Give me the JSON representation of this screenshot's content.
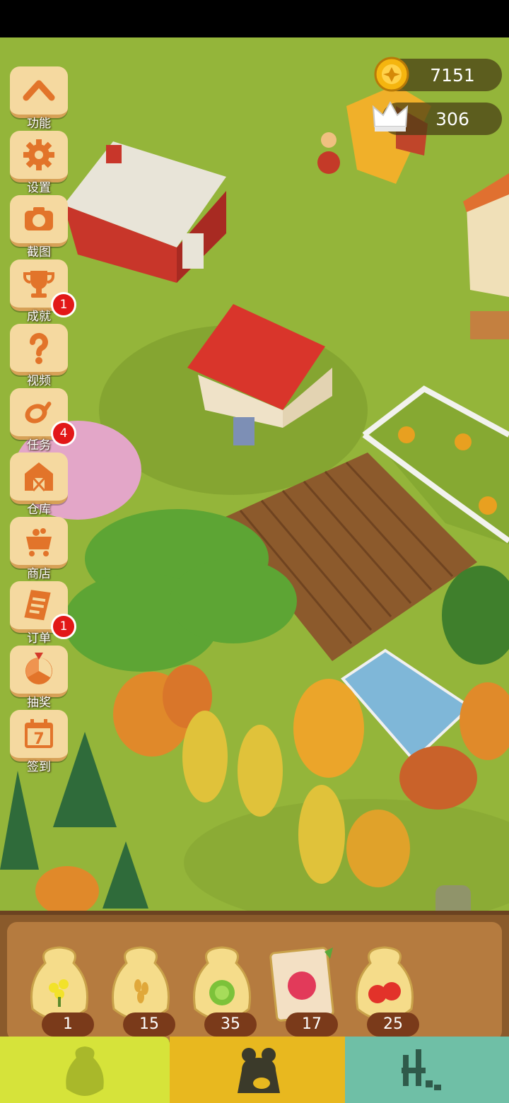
{
  "currency": {
    "coins": "7151",
    "crowns": "306"
  },
  "side_menu": [
    {
      "label": "功能",
      "icon": "chevron-up-icon"
    },
    {
      "label": "设置",
      "icon": "gear-icon"
    },
    {
      "label": "截图",
      "icon": "camera-icon"
    },
    {
      "label": "成就",
      "icon": "trophy-icon",
      "badge": "1"
    },
    {
      "label": "视频",
      "icon": "question-icon"
    },
    {
      "label": "任务",
      "icon": "ham-icon",
      "badge": "4"
    },
    {
      "label": "仓库",
      "icon": "barn-icon"
    },
    {
      "label": "商店",
      "icon": "cart-icon"
    },
    {
      "label": "订单",
      "icon": "order-icon",
      "badge": "1"
    },
    {
      "label": "抽奖",
      "icon": "wheel-icon"
    },
    {
      "label": "签到",
      "icon": "calendar-icon",
      "calendar_day": "7"
    }
  ],
  "seeds": [
    {
      "name": "rapeseed-seed",
      "count": "1"
    },
    {
      "name": "wheat-seed",
      "count": "15"
    },
    {
      "name": "cabbage-seed",
      "count": "35"
    },
    {
      "name": "raspberry-seed",
      "count": "17"
    },
    {
      "name": "tomato-seed",
      "count": "25"
    }
  ],
  "tabs": [
    {
      "icon": "seed-bag-icon",
      "color": "#d6e33a"
    },
    {
      "icon": "animal-icon",
      "color": "#e8b81f"
    },
    {
      "icon": "building-icon",
      "color": "#6fbfa6"
    }
  ]
}
